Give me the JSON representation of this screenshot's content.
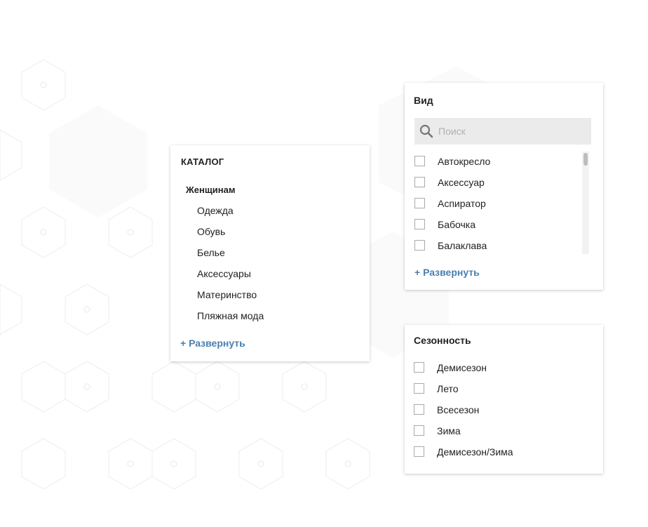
{
  "catalog": {
    "title": "КАТАЛОГ",
    "section": "Женщинам",
    "items": [
      "Одежда",
      "Обувь",
      "Белье",
      "Аксессуары",
      "Материнство",
      "Пляжная мода"
    ],
    "expand_label": "+ Развернуть"
  },
  "filter_vid": {
    "title": "Вид",
    "search_placeholder": "Поиск",
    "options": [
      "Автокресло",
      "Аксессуар",
      "Аспиратор",
      "Бабочка",
      "Балаклава"
    ],
    "expand_label": "+ Развернуть"
  },
  "filter_season": {
    "title": "Сезонность",
    "options": [
      "Демисезон",
      "Лето",
      "Всесезон",
      "Зима",
      "Демисезон/Зима"
    ]
  },
  "colors": {
    "link": "#4a80b0",
    "search_bg": "#ebebeb",
    "hex_pattern": "#eeeeee"
  },
  "icons": {
    "search": "search-icon"
  }
}
